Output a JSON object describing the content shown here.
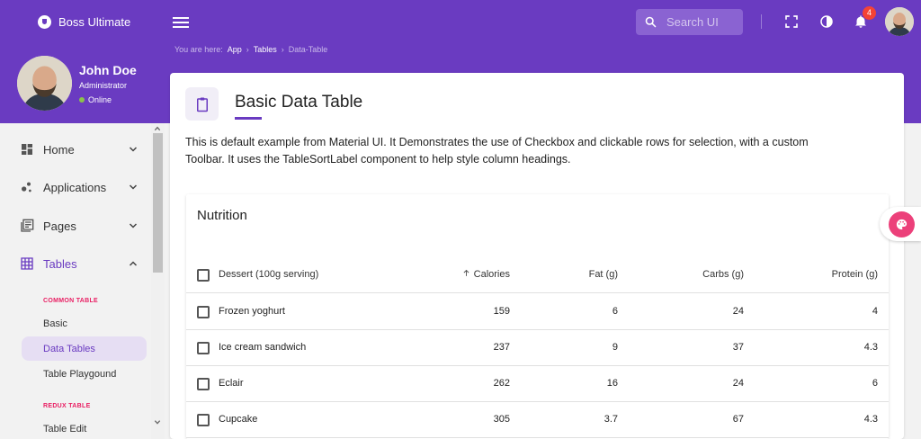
{
  "app": {
    "brand": "Boss Ultimate"
  },
  "search": {
    "placeholder": "Search UI"
  },
  "notifications": {
    "count": "4"
  },
  "breadcrumb": {
    "prefix": "You are here:",
    "items": [
      "App",
      "Tables",
      "Data-Table"
    ],
    "separator": "›"
  },
  "profile": {
    "name": "John Doe",
    "role": "Administrator",
    "status": "Online"
  },
  "sidebar": {
    "items": [
      {
        "label": "Home",
        "icon": "dashboard-icon"
      },
      {
        "label": "Applications",
        "icon": "bubbles-icon"
      },
      {
        "label": "Pages",
        "icon": "pages-icon"
      },
      {
        "label": "Tables",
        "icon": "grid-icon"
      }
    ],
    "groups": [
      {
        "header": "COMMON TABLE",
        "items": [
          "Basic",
          "Data Tables",
          "Table Playgound"
        ]
      },
      {
        "header": "REDUX TABLE",
        "items": [
          "Table Edit"
        ]
      }
    ]
  },
  "page": {
    "title": "Basic Data Table",
    "description": "This is default example from Material UI. It Demonstrates the use of Checkbox and clickable rows for selection, with a custom Toolbar. It uses the TableSortLabel component to help style column headings."
  },
  "table": {
    "title": "Nutrition",
    "columns": [
      "Dessert (100g serving)",
      "Calories",
      "Fat (g)",
      "Carbs (g)",
      "Protein (g)"
    ],
    "rows": [
      [
        "Frozen yoghurt",
        "159",
        "6",
        "24",
        "4"
      ],
      [
        "Ice cream sandwich",
        "237",
        "9",
        "37",
        "4.3"
      ],
      [
        "Eclair",
        "262",
        "16",
        "24",
        "6"
      ],
      [
        "Cupcake",
        "305",
        "3.7",
        "67",
        "4.3"
      ]
    ]
  },
  "colors": {
    "primary": "#6a3bc1",
    "accent": "#e91e63",
    "palette": "#ec407a"
  }
}
